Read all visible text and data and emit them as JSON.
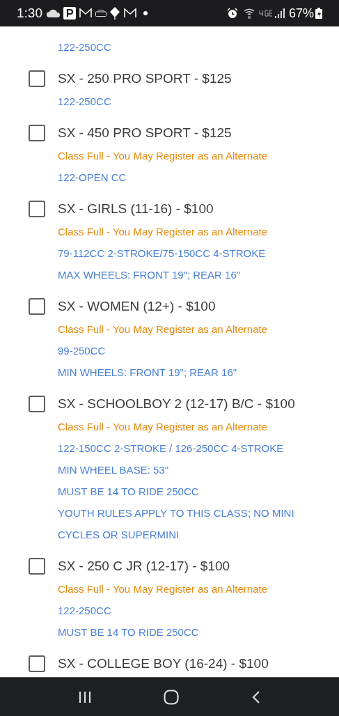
{
  "status_bar": {
    "time": "1:30",
    "battery": "67%"
  },
  "classes": [
    {
      "notes": [
        {
          "kind": "spec",
          "text": "122-250CC"
        }
      ]
    },
    {
      "title": "SX - 250 PRO SPORT - $125",
      "checked": false,
      "notes": [
        {
          "kind": "spec",
          "text": "122-250CC"
        }
      ]
    },
    {
      "title": "SX - 450 PRO SPORT - $125",
      "checked": false,
      "notes": [
        {
          "kind": "full",
          "text": "Class Full - You May Register as an Alternate"
        },
        {
          "kind": "spec",
          "text": "122-OPEN CC"
        }
      ]
    },
    {
      "title": "SX - GIRLS (11-16) - $100",
      "checked": false,
      "notes": [
        {
          "kind": "full",
          "text": "Class Full - You May Register as an Alternate"
        },
        {
          "kind": "spec",
          "text": "79-112CC 2-STROKE/75-150CC 4-STROKE"
        },
        {
          "kind": "spec",
          "text": "MAX WHEELS: FRONT 19\"; REAR 16\""
        }
      ]
    },
    {
      "title": "SX - WOMEN (12+) - $100",
      "checked": false,
      "notes": [
        {
          "kind": "full",
          "text": "Class Full - You May Register as an Alternate"
        },
        {
          "kind": "spec",
          "text": "99-250CC"
        },
        {
          "kind": "spec",
          "text": "MIN WHEELS: FRONT 19\"; REAR 16\""
        }
      ]
    },
    {
      "title": "SX - SCHOOLBOY 2 (12-17) B/C - $100",
      "checked": false,
      "notes": [
        {
          "kind": "full",
          "text": "Class Full - You May Register as an Alternate"
        },
        {
          "kind": "spec",
          "text": "122-150CC 2-STROKE / 126-250CC 4-STROKE"
        },
        {
          "kind": "spec",
          "text": "MIN WHEEL BASE: 53\""
        },
        {
          "kind": "spec",
          "text": "MUST BE 14 TO RIDE 250CC"
        },
        {
          "kind": "spec",
          "text": "YOUTH RULES APPLY TO THIS CLASS; NO MINI CYCLES OR SUPERMINI"
        }
      ]
    },
    {
      "title": "SX - 250 C JR (12-17) - $100",
      "checked": false,
      "notes": [
        {
          "kind": "full",
          "text": "Class Full - You May Register as an Alternate"
        },
        {
          "kind": "spec",
          "text": "122-250CC"
        },
        {
          "kind": "spec",
          "text": "MUST BE 14 TO RIDE 250CC"
        }
      ]
    },
    {
      "title": "SX - COLLEGE BOY (16-24) - $100",
      "checked": false
    }
  ]
}
